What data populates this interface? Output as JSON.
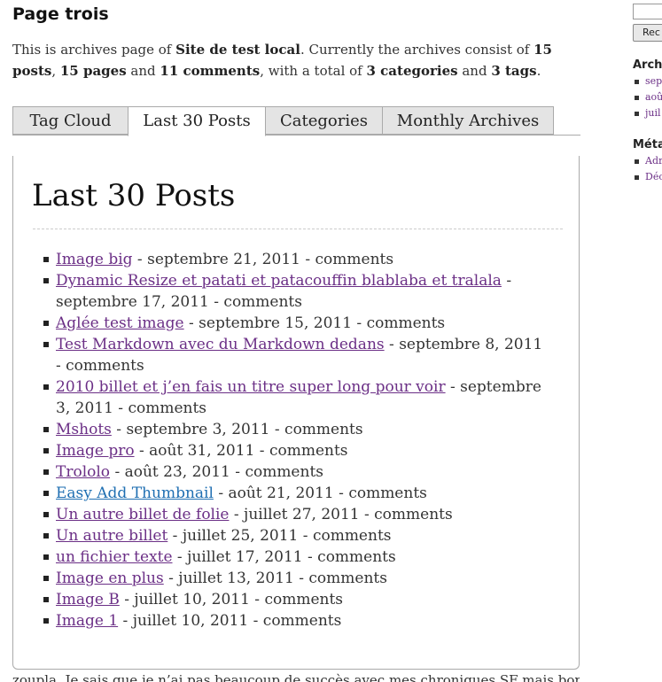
{
  "page": {
    "title": "Page trois",
    "intro": [
      {
        "text": "This is archives page of ",
        "bold": false
      },
      {
        "text": "Site de test local",
        "bold": true
      },
      {
        "text": ". Currently the archives consist of ",
        "bold": false
      },
      {
        "text": "15 posts",
        "bold": true
      },
      {
        "text": ", ",
        "bold": false
      },
      {
        "text": "15 pages",
        "bold": true
      },
      {
        "text": " and ",
        "bold": false
      },
      {
        "text": "11 comments",
        "bold": true
      },
      {
        "text": ", with a total of ",
        "bold": false
      },
      {
        "text": "3 categories",
        "bold": true
      },
      {
        "text": " and ",
        "bold": false
      },
      {
        "text": "3 tags",
        "bold": true
      },
      {
        "text": ".",
        "bold": false
      }
    ]
  },
  "tabs": [
    "Tag Cloud",
    "Last 30 Posts",
    "Categories",
    "Monthly Archives"
  ],
  "active_tab": "Last 30 Posts",
  "panel": {
    "title": "Last 30 Posts",
    "posts": [
      {
        "title": "Image big",
        "date": "septembre 21, 2011",
        "comments": "comments",
        "visited": false
      },
      {
        "title": "Dynamic Resize et patati et patacouffin blablaba et tralala",
        "date": "septembre 17, 2011",
        "comments": "comments",
        "visited": false
      },
      {
        "title": "Aglée test image",
        "date": "septembre 15, 2011",
        "comments": "comments",
        "visited": false
      },
      {
        "title": "Test Markdown avec du Markdown dedans",
        "date": "septembre 8, 2011",
        "comments": "comments",
        "visited": false
      },
      {
        "title": "2010 billet et j’en fais un titre super long pour voir",
        "date": "septembre 3, 2011",
        "comments": "comments",
        "visited": false
      },
      {
        "title": "Mshots",
        "date": "septembre 3, 2011",
        "comments": "comments",
        "visited": false
      },
      {
        "title": "Image pro",
        "date": "août 31, 2011",
        "comments": "comments",
        "visited": false
      },
      {
        "title": "Trololo",
        "date": "août 23, 2011",
        "comments": "comments",
        "visited": false
      },
      {
        "title": "Easy Add Thumbnail",
        "date": "août 21, 2011",
        "comments": "comments",
        "visited": true
      },
      {
        "title": "Un autre billet de folie",
        "date": "juillet 27, 2011",
        "comments": "comments",
        "visited": false
      },
      {
        "title": "Un autre billet",
        "date": "juillet 25, 2011",
        "comments": "comments",
        "visited": false
      },
      {
        "title": "un fichier texte",
        "date": "juillet 17, 2011",
        "comments": "comments",
        "visited": false
      },
      {
        "title": "Image en plus",
        "date": "juillet 13, 2011",
        "comments": "comments",
        "visited": false
      },
      {
        "title": "Image B",
        "date": "juillet 10, 2011",
        "comments": "comments",
        "visited": false
      },
      {
        "title": "Image 1",
        "date": "juillet 10, 2011",
        "comments": "comments",
        "visited": false
      }
    ],
    "separator": " - "
  },
  "bottom_text": "zoupla. Je sais que je n’ai pas beaucoup de succès avec mes chroniques SF mais bon, moi ça",
  "sidebar": {
    "search_button": "Rec",
    "archives_heading": "Arch",
    "archives": [
      "sep",
      "aoû",
      "juil"
    ],
    "meta_heading": "Méta",
    "meta": [
      "Adr",
      "Déc"
    ]
  },
  "colors": {
    "link": "#6b2f86",
    "link_visited": "#1f6fb2",
    "tab_inactive": "#e4e4e4",
    "border": "#aaaaaa"
  }
}
